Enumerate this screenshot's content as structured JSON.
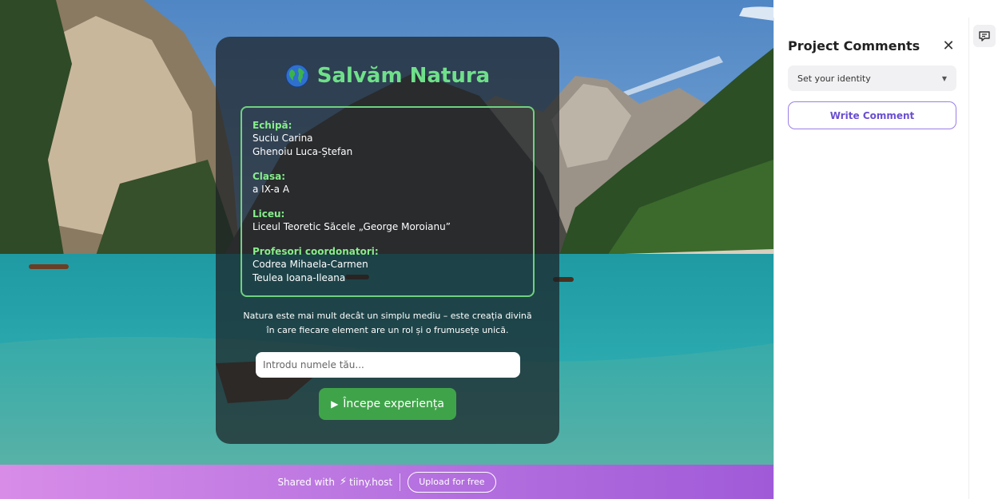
{
  "card": {
    "title": "Salvăm Natura",
    "team_label": "Echipă:",
    "team_members": [
      "Suciu Carina",
      "Ghenoiu Luca-Ștefan"
    ],
    "class_label": "Clasa:",
    "class_value": "a IX-a A",
    "school_label": "Liceu:",
    "school_value": "Liceul Teoretic Săcele „George Moroianu”",
    "teachers_label": "Profesori coordonatori:",
    "teachers": [
      "Codrea Mihaela-Carmen",
      "Teulea Ioana-Ileana"
    ],
    "description": "Natura este mai mult decât un simplu mediu – este creația divină în care fiecare element are un rol și o frumusețe unică.",
    "name_placeholder": "Introdu numele tău...",
    "start_button": "Începe experiența",
    "start_icon": "play-icon",
    "title_icon": "globe-icon",
    "accent_color": "#6fe08a",
    "button_color": "#3fa449"
  },
  "share_bar": {
    "shared_with": "Shared with",
    "brand": "tiiny.host",
    "brand_icon": "bolt-icon",
    "upload_button": "Upload for free"
  },
  "comments_panel": {
    "title": "Project Comments",
    "close_icon": "close-icon",
    "identity_select": "Set your identity",
    "write_button": "Write Comment",
    "toggle_icon": "chat-bubble-icon"
  }
}
